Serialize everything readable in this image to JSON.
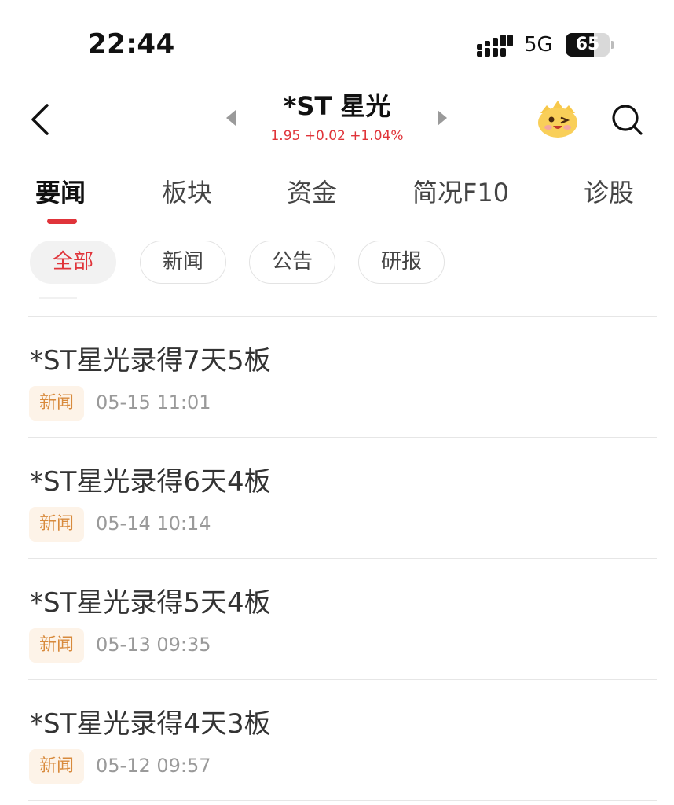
{
  "status_bar": {
    "time": "22:44",
    "network": "5G",
    "battery_level": "65",
    "battery_fraction": 0.65
  },
  "header": {
    "stock_name": "*ST 星光",
    "quote": "1.95 +0.02 +1.04%",
    "icons": [
      "back-icon",
      "prev-stock-icon",
      "next-stock-icon",
      "mascot-icon",
      "search-icon"
    ]
  },
  "tabs": [
    {
      "label": "要闻",
      "active": true
    },
    {
      "label": "板块"
    },
    {
      "label": "资金"
    },
    {
      "label": "简况F10"
    },
    {
      "label": "诊股"
    }
  ],
  "filters": [
    {
      "label": "全部",
      "active": true
    },
    {
      "label": "新闻"
    },
    {
      "label": "公告"
    },
    {
      "label": "研报"
    }
  ],
  "news": [
    {
      "title": "*ST星光录得7天5板",
      "tag": "新闻",
      "time": "05-15 11:01"
    },
    {
      "title": "*ST星光录得6天4板",
      "tag": "新闻",
      "time": "05-14 10:14"
    },
    {
      "title": "*ST星光录得5天4板",
      "tag": "新闻",
      "time": "05-13 09:35"
    },
    {
      "title": "*ST星光录得4天3板",
      "tag": "新闻",
      "time": "05-12 09:57"
    }
  ],
  "colors": {
    "accent_red": "#e0343a",
    "tag_bg": "#fdf3e8",
    "tag_text": "#d88a3c"
  }
}
